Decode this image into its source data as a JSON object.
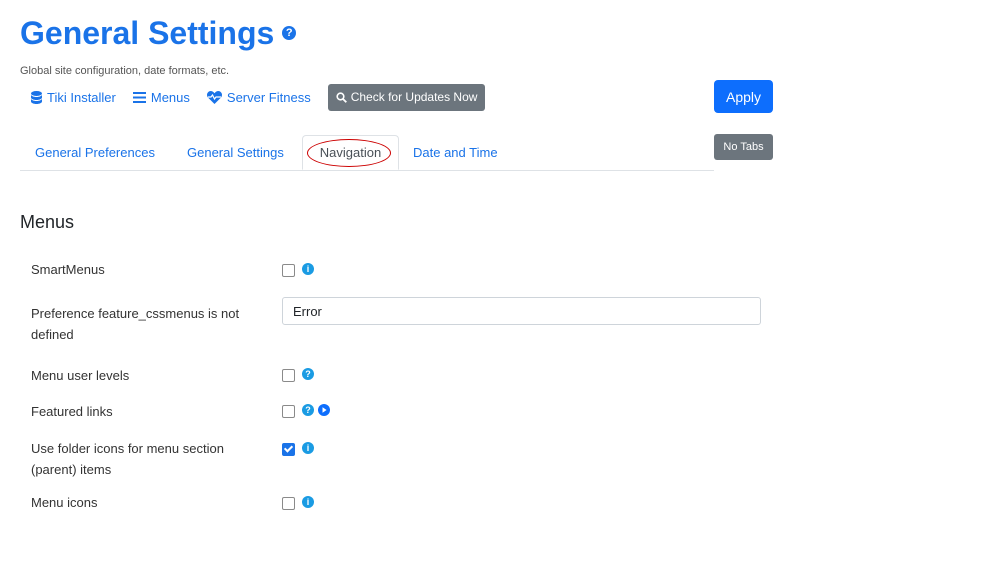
{
  "header": {
    "title": "General Settings",
    "help_glyph": "?",
    "description": "Global site configuration, date formats, etc."
  },
  "toolbar": {
    "links": [
      {
        "label": "Tiki Installer",
        "icon": "database-icon"
      },
      {
        "label": "Menus",
        "icon": "bars-icon"
      },
      {
        "label": "Server Fitness",
        "icon": "heartbeat-icon"
      }
    ],
    "check_updates": {
      "label": "Check for Updates Now",
      "icon": "search-icon"
    },
    "apply_label": "Apply",
    "no_tabs_label": "No Tabs"
  },
  "tabs": [
    {
      "label": "General Preferences",
      "active": false
    },
    {
      "label": "General Settings",
      "active": false
    },
    {
      "label": "Navigation",
      "active": true
    },
    {
      "label": "Date and Time",
      "active": false
    }
  ],
  "section": {
    "title": "Menus",
    "rows": [
      {
        "label": "SmartMenus",
        "control": "checkbox",
        "checked": false,
        "icons": [
          "info-icon"
        ]
      },
      {
        "label": "Preference feature_cssmenus is not defined",
        "control": "text",
        "value": "Error"
      },
      {
        "label": "Menu user levels",
        "control": "checkbox",
        "checked": false,
        "icons": [
          "help-icon"
        ]
      },
      {
        "label": "Featured links",
        "control": "checkbox",
        "checked": false,
        "icons": [
          "help-icon",
          "play-icon"
        ]
      },
      {
        "label": "Use folder icons for menu section (parent) items",
        "control": "checkbox",
        "checked": true,
        "icons": [
          "info-icon"
        ]
      },
      {
        "label": "Menu icons",
        "control": "checkbox",
        "checked": false,
        "icons": [
          "info-icon"
        ]
      }
    ]
  },
  "colors": {
    "accent": "#1a73e8",
    "primary_button": "#0d6efd",
    "secondary_button": "#6c757d",
    "highlight_oval": "#cc0000"
  }
}
